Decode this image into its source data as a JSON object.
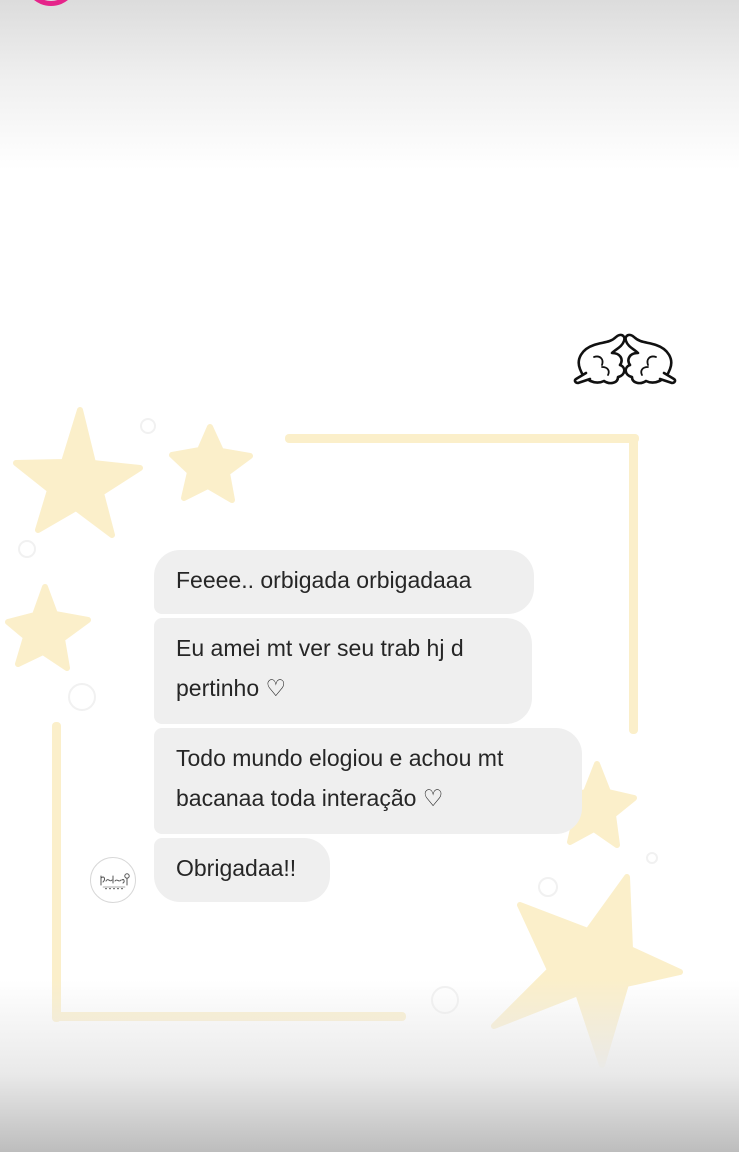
{
  "messages": [
    {
      "text": "Feeee.. orbigada orbigadaaa"
    },
    {
      "text": "Eu amei mt ver seu trab hj d\npertinho ♡"
    },
    {
      "text": "Todo mundo elogiou e achou mt\nbacanaa toda interação ♡"
    },
    {
      "text": "Obrigadaa!!"
    }
  ],
  "sender": {
    "avatar_icon": "brand-logo-avatar"
  },
  "decorations": {
    "star_color": "#fbefca",
    "frame_color": "#fbefca",
    "story_ring_color": "#e5248a",
    "sticker_icon": "gloved-hands-sticker"
  }
}
